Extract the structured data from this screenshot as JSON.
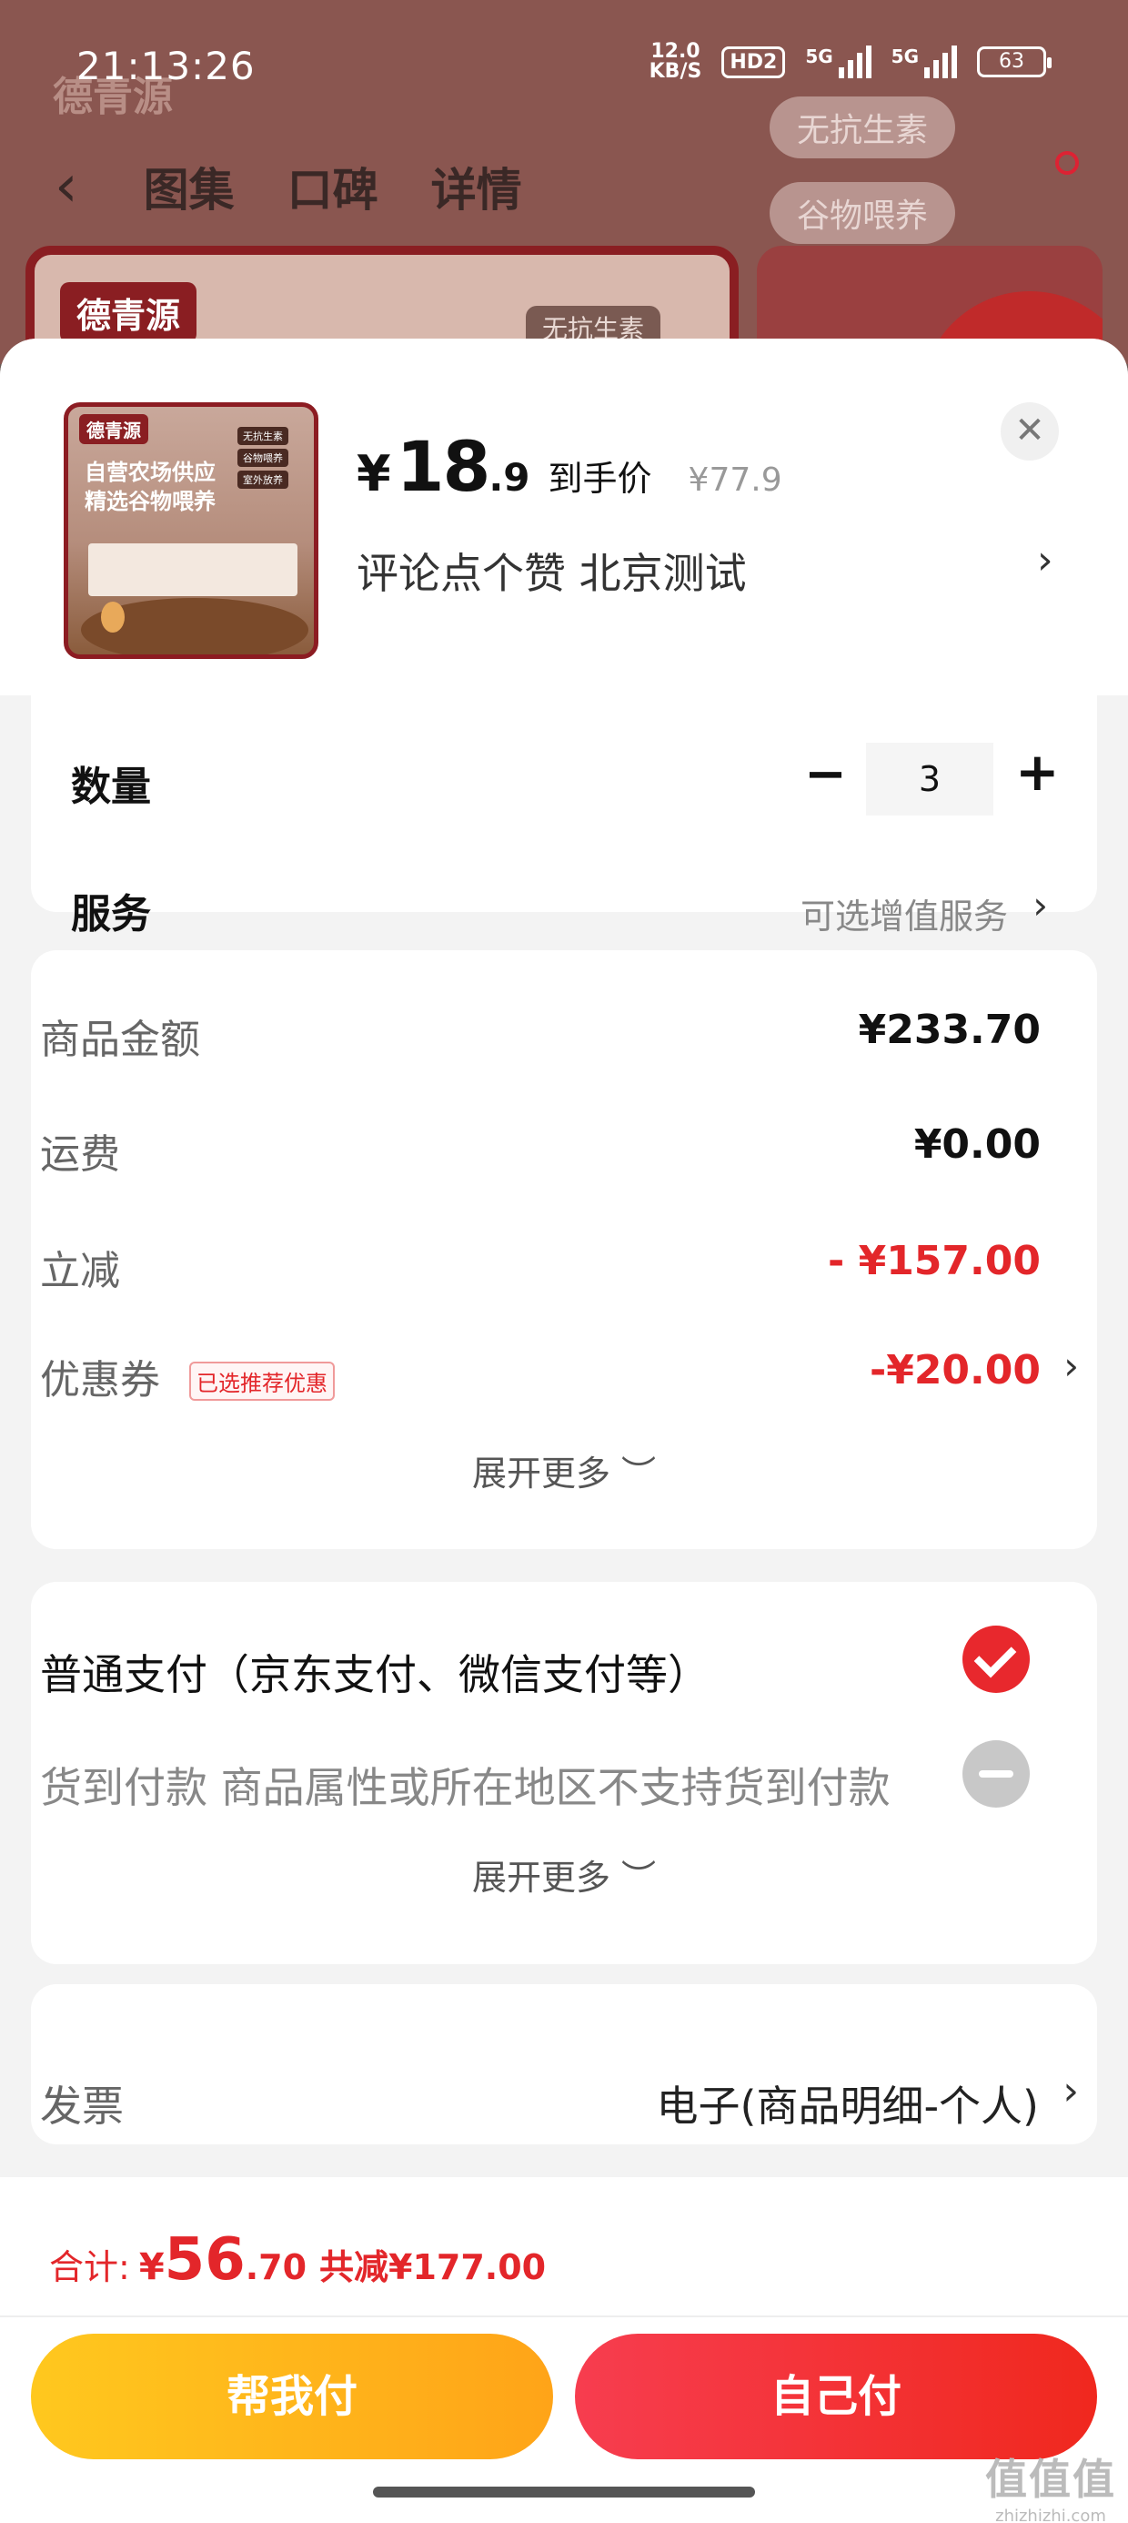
{
  "status_bar": {
    "time": "21:13:26",
    "net_speed_value": "12.0",
    "net_speed_unit": "KB/S",
    "hd": "HD2",
    "sig1": "5G",
    "sig2": "5G",
    "battery": "63"
  },
  "background": {
    "brand": "德青源",
    "nav_tabs": [
      "图集",
      "口碑",
      "详情"
    ],
    "tags": [
      "无抗生素",
      "谷物喂养"
    ],
    "card_tag": "无抗生素"
  },
  "product": {
    "thumb_brand": "德青源",
    "thumb_line1": "自营农场供应",
    "thumb_line2": "精选谷物喂养",
    "thumb_tags": [
      "无抗生素",
      "谷物喂养",
      "室外放养"
    ],
    "price_symbol": "¥",
    "price_int": "18",
    "price_dec": ".9",
    "price_label": "到手价",
    "original_price": "¥77.9",
    "variant": "评论点个赞  北京测试"
  },
  "options": {
    "quantity_label": "数量",
    "quantity_value": "3",
    "service_label": "服务",
    "service_value": "可选增值服务"
  },
  "fees": {
    "goods_label": "商品金额",
    "goods_value": "¥233.70",
    "shipping_label": "运费",
    "shipping_value": "¥0.00",
    "discount_label": "立减",
    "discount_value": "- ¥157.00",
    "coupon_label": "优惠券",
    "coupon_badge": "已选推荐优惠",
    "coupon_value": "-¥20.00",
    "expand_label": "展开更多"
  },
  "payment": {
    "option1": "普通支付（京东支付、微信支付等）",
    "option2": "货到付款 商品属性或所在地区不支持货到付款",
    "expand_label": "展开更多"
  },
  "invoice": {
    "label": "发票",
    "value": "电子(商品明细-个人)"
  },
  "footer": {
    "total_label": "合计:",
    "total_yen": "¥",
    "total_int": "56",
    "total_dec": ".70",
    "total_saved": "共减¥177.00",
    "help_pay": "帮我付",
    "self_pay": "自己付"
  },
  "watermark": {
    "main": "值值值",
    "sub": "zhizhizhi.com"
  },
  "colors": {
    "accent_red": "#e3262a",
    "help_pay_yellow": "#ffb31e",
    "self_pay_red": "#f3303a"
  }
}
